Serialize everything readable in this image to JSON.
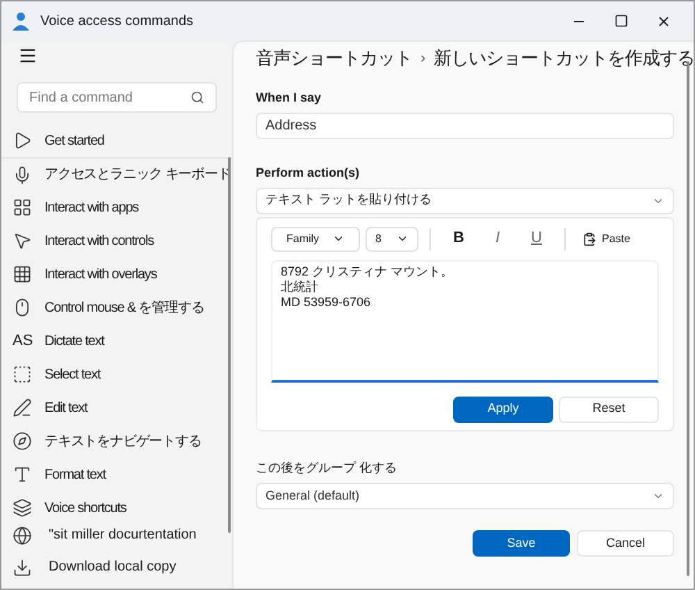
{
  "window": {
    "title": "Voice access commands"
  },
  "sidebar": {
    "search": {
      "placeholder": "Find a command"
    },
    "items": [
      {
        "label": "Get started",
        "selected": false
      },
      {
        "label": "アクセスとラニック キーボード",
        "selected": false
      },
      {
        "label": "Interact with apps",
        "selected": false
      },
      {
        "label": "Interact with controls",
        "selected": false
      },
      {
        "label": "Interact with overlays",
        "selected": false
      },
      {
        "label": "Control mouse & を管理する",
        "selected": false
      },
      {
        "label": "Dictate text",
        "glyph": "AS",
        "selected": false
      },
      {
        "label": "Select text",
        "selected": false
      },
      {
        "label": "Edit text",
        "selected": false
      },
      {
        "label": "テキストをナビゲートする",
        "selected": false
      },
      {
        "label": "Format text",
        "selected": false
      },
      {
        "label": "Voice shortcuts",
        "selected": false
      }
    ],
    "footer": [
      {
        "label": "\"sit miller docurtentation"
      },
      {
        "label": "Download local copy"
      }
    ]
  },
  "breadcrumb": {
    "parent": "音声ショートカット",
    "separator": "›",
    "current": "新しいショートカットを作成する"
  },
  "when_i_say": {
    "label": "When I say",
    "value": "Address"
  },
  "perform_actions": {
    "label": "Perform action(s)",
    "value": "テキスト ラットを貼り付ける",
    "editor": {
      "font_family": "Family",
      "font_size": "8",
      "bold": "B",
      "italic": "I",
      "underline": "U",
      "paste": "Paste",
      "lines": [
        "8792 クリスティナ マウント。",
        "北統計",
        "MD 53959-6706"
      ],
      "apply": "Apply",
      "reset": "Reset"
    }
  },
  "group": {
    "label": "この後をグループ 化する",
    "value": "General (default)"
  },
  "buttons": {
    "save": "Save",
    "cancel": "Cancel"
  }
}
